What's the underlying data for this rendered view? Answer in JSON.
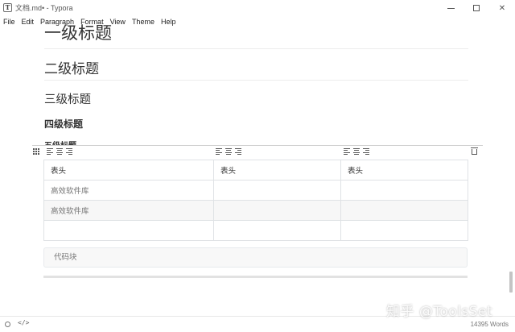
{
  "window": {
    "title": "文档.md• - Typora",
    "app_icon_letter": "T",
    "controls": {
      "minimize": "minimize-icon",
      "maximize": "maximize-icon",
      "close": "close-icon"
    }
  },
  "menu": [
    "File",
    "Edit",
    "Paragraph",
    "Format",
    "View",
    "Theme",
    "Help"
  ],
  "document": {
    "h1": "一级标题",
    "h2": "二级标题",
    "h3": "三级标题",
    "h4": "四级标题",
    "h5": "五级标题",
    "table": {
      "headers": [
        "表头",
        "表头",
        "表头"
      ],
      "rows": [
        [
          "高效软件库",
          "",
          ""
        ],
        [
          "高效软件库",
          "",
          ""
        ],
        [
          "",
          "",
          ""
        ]
      ]
    },
    "code_block": "代码块"
  },
  "status_bar": {
    "source_toggle": "</>",
    "word_count": "14395 Words"
  },
  "watermark": "知乎 @ToolsSet",
  "colors": {
    "border": "#dfe2e5",
    "code_bg": "#f8f8f8",
    "text": "#333333"
  }
}
